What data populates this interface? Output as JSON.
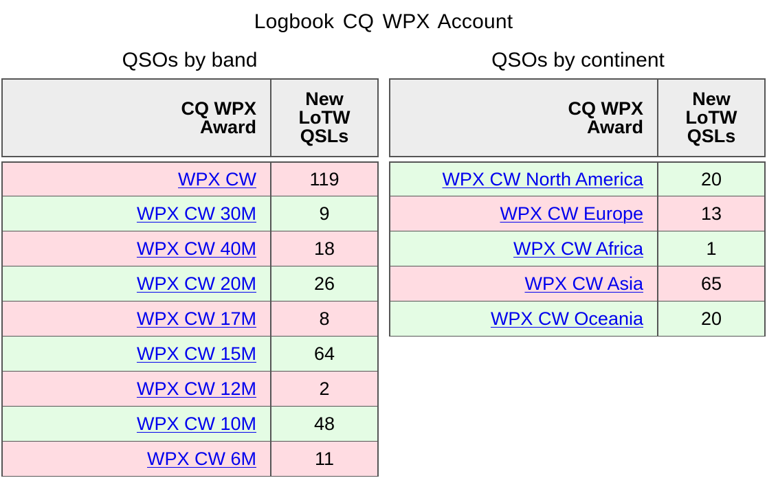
{
  "page": {
    "title": "Logbook  CQ WPX Account"
  },
  "band_section": {
    "caption": "QSOs by band",
    "headers": {
      "award": "CQ WPX Award",
      "new": "New LoTW QSLs"
    },
    "rows": [
      {
        "award": "WPX CW",
        "count": "119",
        "color": "#ffdce2"
      },
      {
        "award": "WPX CW 30M",
        "count": "9",
        "color": "#e4fce4"
      },
      {
        "award": "WPX CW 40M",
        "count": "18",
        "color": "#ffdce2"
      },
      {
        "award": "WPX CW 20M",
        "count": "26",
        "color": "#e4fce4"
      },
      {
        "award": "WPX CW 17M",
        "count": "8",
        "color": "#ffdce2"
      },
      {
        "award": "WPX CW 15M",
        "count": "64",
        "color": "#e4fce4"
      },
      {
        "award": "WPX CW 12M",
        "count": "2",
        "color": "#ffdce2"
      },
      {
        "award": "WPX CW 10M",
        "count": "48",
        "color": "#e4fce4"
      },
      {
        "award": "WPX CW 6M",
        "count": "11",
        "color": "#ffdce2"
      }
    ]
  },
  "continent_section": {
    "caption": "QSOs by continent",
    "headers": {
      "award": "CQ WPX Award",
      "new": "New LoTW QSLs"
    },
    "rows": [
      {
        "award": "WPX CW North America",
        "count": "20",
        "color": "#e4fce4"
      },
      {
        "award": "WPX CW Europe",
        "count": "13",
        "color": "#ffdce2"
      },
      {
        "award": "WPX CW Africa",
        "count": "1",
        "color": "#e4fce4"
      },
      {
        "award": "WPX CW Asia",
        "count": "65",
        "color": "#ffdce2"
      },
      {
        "award": "WPX CW Oceania",
        "count": "20",
        "color": "#e4fce4"
      }
    ]
  },
  "colors": {
    "header_bg": "#ededed",
    "row_pink": "#ffdce2",
    "row_green": "#e4fce4",
    "link": "#0000ee",
    "border": "#555555"
  }
}
